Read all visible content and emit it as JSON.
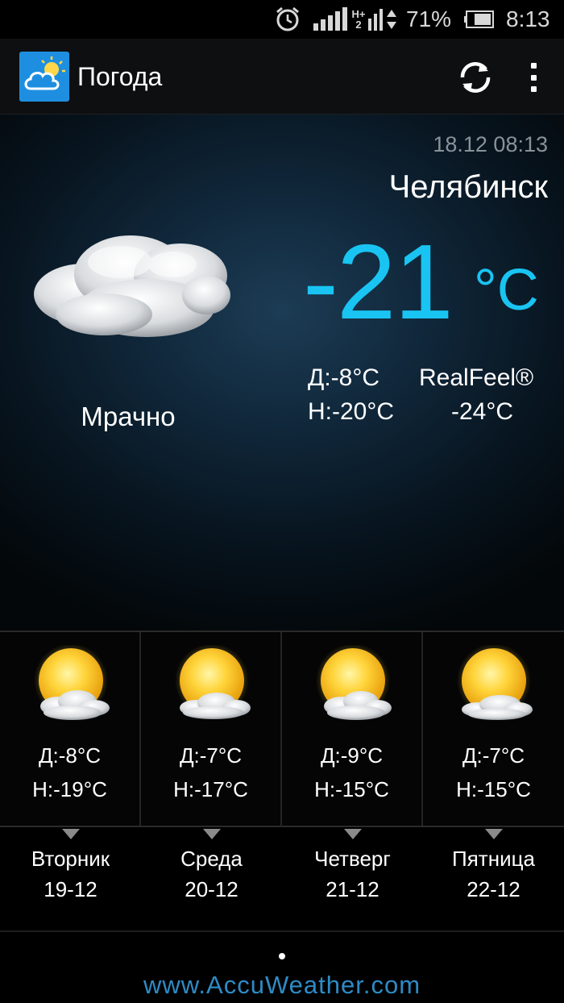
{
  "status_bar": {
    "network_type": "H+",
    "sim_slot": "2",
    "battery_percent": "71%",
    "time": "8:13",
    "icons": [
      "alarm-icon",
      "signal-icon",
      "data-arrows-icon",
      "battery-icon"
    ]
  },
  "action_bar": {
    "title": "Погода",
    "app_icon": "weather-app-icon",
    "refresh_icon": "refresh-icon",
    "overflow_icon": "overflow-menu-icon"
  },
  "current": {
    "updated": "18.12 08:13",
    "city": "Челябинск",
    "temperature": "-21",
    "unit": "°C",
    "condition": "Мрачно",
    "condition_icon": "cloudy-icon",
    "day_high": "Д:-8°C",
    "night_low": "Н:-20°C",
    "realfeel_label": "RealFeel®",
    "realfeel_value": "-24°C"
  },
  "forecast": [
    {
      "day": "Вторник",
      "date": "19-12",
      "high": "Д:-8°C",
      "low": "Н:-19°C",
      "icon": "partly-sunny-icon"
    },
    {
      "day": "Среда",
      "date": "20-12",
      "high": "Д:-7°C",
      "low": "Н:-17°C",
      "icon": "partly-sunny-icon"
    },
    {
      "day": "Четверг",
      "date": "21-12",
      "high": "Д:-9°C",
      "low": "Н:-15°C",
      "icon": "partly-sunny-icon"
    },
    {
      "day": "Пятница",
      "date": "22-12",
      "high": "Д:-7°C",
      "low": "Н:-15°C",
      "icon": "partly-sunny-icon"
    }
  ],
  "footer": {
    "link": "www.AccuWeather.com"
  },
  "colors": {
    "accent": "#19c4f2",
    "app_icon_bg": "#1e8fe0",
    "footer_link": "#2e8bc6"
  }
}
